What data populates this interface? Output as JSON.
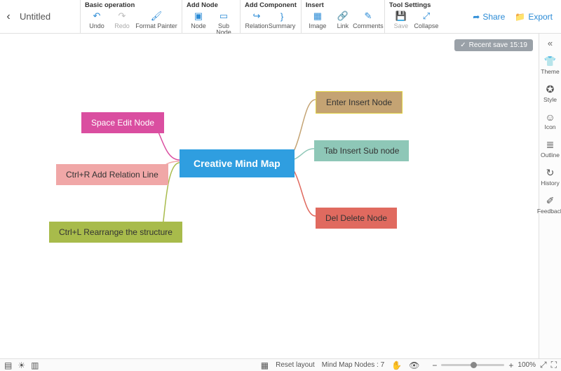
{
  "title": "Untitled",
  "toolbar": {
    "groups": [
      {
        "title": "Basic operation",
        "items": [
          {
            "label": "Undo",
            "icon": "↶",
            "disabled": false
          },
          {
            "label": "Redo",
            "icon": "↷",
            "disabled": true
          },
          {
            "label": "Format Painter",
            "icon": "🖌",
            "disabled": false,
            "wide": true
          }
        ]
      },
      {
        "title": "Add Node",
        "items": [
          {
            "label": "Node",
            "icon": "▣"
          },
          {
            "label": "Sub Node",
            "icon": "▭"
          }
        ]
      },
      {
        "title": "Add Component",
        "items": [
          {
            "label": "Relation",
            "icon": "↪"
          },
          {
            "label": "Summary",
            "icon": "}"
          }
        ]
      },
      {
        "title": "Insert",
        "items": [
          {
            "label": "Image",
            "icon": "▦"
          },
          {
            "label": "Link",
            "icon": "🔗"
          },
          {
            "label": "Comments",
            "icon": "✎"
          }
        ]
      },
      {
        "title": "Tool Settings",
        "items": [
          {
            "label": "Save",
            "icon": "💾",
            "disabled": true
          },
          {
            "label": "Collapse",
            "icon": "⤢"
          }
        ]
      }
    ],
    "share": "Share",
    "export": "Export"
  },
  "save_badge": "Recent save 15:19",
  "sidebar": {
    "items": [
      {
        "label": "Theme",
        "icon": "👕"
      },
      {
        "label": "Style",
        "icon": "✪"
      },
      {
        "label": "Icon",
        "icon": "☺"
      },
      {
        "label": "Outline",
        "icon": "≣"
      },
      {
        "label": "History",
        "icon": "↻"
      },
      {
        "label": "Feedback",
        "icon": "✐"
      }
    ]
  },
  "mindmap": {
    "center": "Creative Mind Map",
    "left": [
      {
        "text": "Space Edit Node",
        "cls": "n-pink"
      },
      {
        "text": "Ctrl+R Add Relation Line",
        "cls": "n-salmon"
      },
      {
        "text": "Ctrl+L Rearrange the structure",
        "cls": "n-olive"
      }
    ],
    "right": [
      {
        "text": "Enter Insert Node",
        "cls": "n-tan"
      },
      {
        "text": "Tab Insert Sub node",
        "cls": "n-teal"
      },
      {
        "text": "Del Delete Node",
        "cls": "n-red"
      }
    ]
  },
  "bottombar": {
    "reset": "Reset layout",
    "nodes_label": "Mind Map Nodes :",
    "nodes_count": "7",
    "zoom_pct": "100%"
  }
}
